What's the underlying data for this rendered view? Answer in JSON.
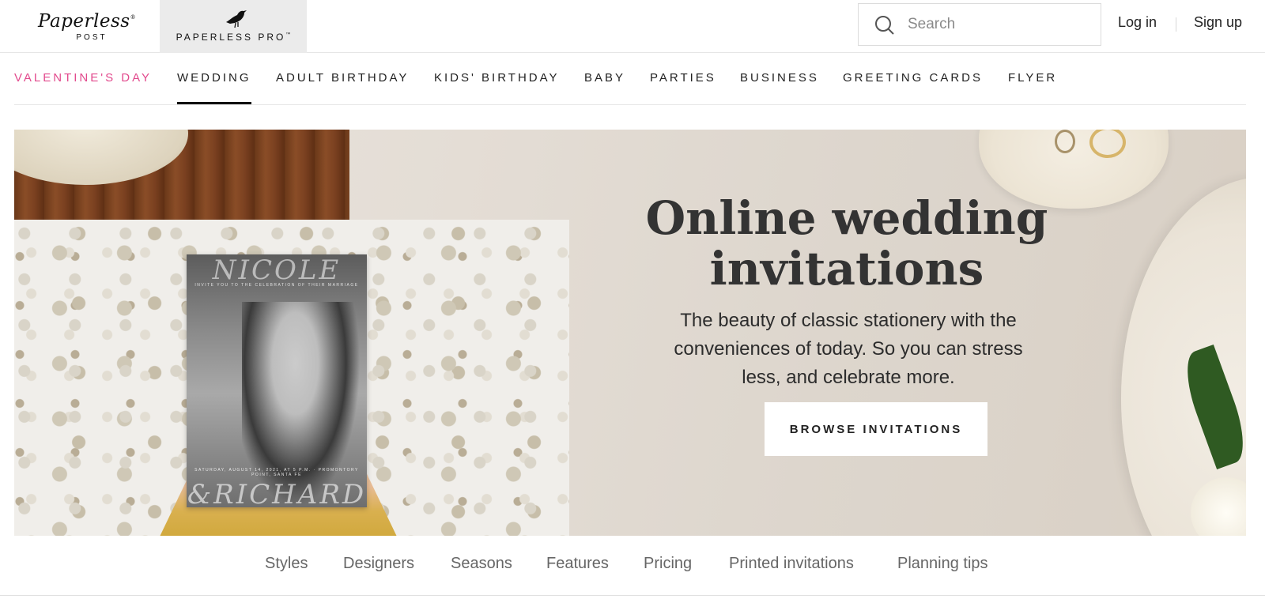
{
  "header": {
    "logo_primary": "Paperless",
    "logo_primary_mark": "®",
    "logo_primary_sub": "POST",
    "logo_pro": "PAPERLESS PRO",
    "logo_pro_mark": "™",
    "search_placeholder": "Search",
    "login_label": "Log in",
    "signup_label": "Sign up"
  },
  "categories": [
    {
      "label": "VALENTINE'S DAY"
    },
    {
      "label": "WEDDING"
    },
    {
      "label": "ADULT BIRTHDAY"
    },
    {
      "label": "KIDS' BIRTHDAY"
    },
    {
      "label": "BABY"
    },
    {
      "label": "PARTIES"
    },
    {
      "label": "BUSINESS"
    },
    {
      "label": "GREETING CARDS"
    },
    {
      "label": "FLYER"
    }
  ],
  "active_category": "WEDDING",
  "hero": {
    "title": "Online wedding invitations",
    "description": "The beauty of classic stationery with the conveniences of today. So you can stress less, and celebrate more.",
    "cta_label": "BROWSE INVITATIONS",
    "card": {
      "name_top": "NICOLE",
      "invite_line": "INVITE YOU TO THE CELEBRATION OF THEIR MARRIAGE",
      "date_line": "SATURDAY, AUGUST 14, 2021, AT 5 P.M. · PROMONTORY POINT, SANTA FE",
      "name_bottom": "&RICHARD"
    }
  },
  "subnav": [
    {
      "label": "Styles"
    },
    {
      "label": "Designers"
    },
    {
      "label": "Seasons"
    },
    {
      "label": "Features"
    },
    {
      "label": "Pricing"
    },
    {
      "label": "Printed invitations"
    },
    {
      "label": "Planning tips"
    }
  ],
  "colors": {
    "promo_pink": "#e24a8d",
    "text_dark": "#222222",
    "subnav_gray": "#666666",
    "pro_bg": "#ebebeb"
  },
  "icons": {
    "search": "search-icon",
    "bird": "bird-logo-icon"
  }
}
